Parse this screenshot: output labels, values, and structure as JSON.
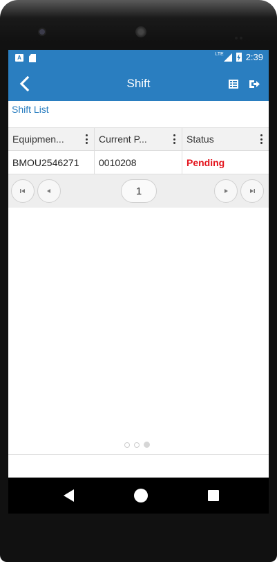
{
  "status_bar": {
    "network": "LTE",
    "time": "2:39",
    "notification_icons": [
      "a-icon",
      "sd-card-icon"
    ]
  },
  "app_bar": {
    "title": "Shift",
    "back_icon": "chevron-left-icon",
    "list_icon": "list-view-icon",
    "logout_icon": "logout-icon"
  },
  "section_label": "Shift List",
  "table": {
    "columns": [
      "Equipmen...",
      "Current P...",
      "Status"
    ],
    "rows": [
      [
        "BMOU2546271",
        "0010208",
        "Pending"
      ]
    ]
  },
  "pager": {
    "current_page": "1"
  },
  "page_indicator": {
    "count": 3,
    "active_index": 2
  },
  "colors": {
    "primary": "#2a7ec0",
    "status_pending": "#e3121b",
    "header_bg": "#f2f2f2",
    "pager_bg": "#eeeeee"
  }
}
